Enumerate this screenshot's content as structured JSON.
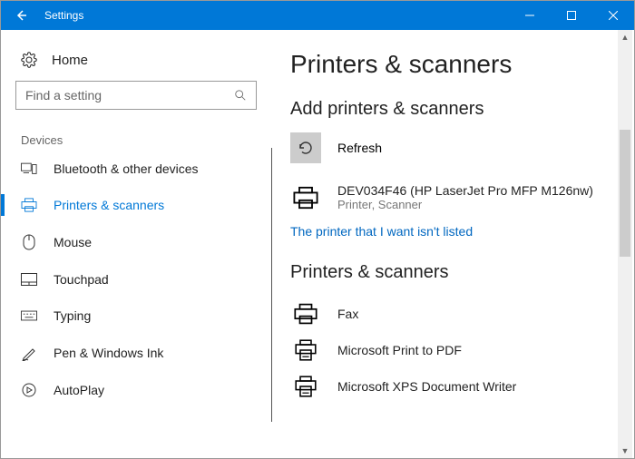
{
  "window": {
    "title": "Settings"
  },
  "sidebar": {
    "home_label": "Home",
    "search_placeholder": "Find a setting",
    "section_label": "Devices",
    "items": [
      {
        "label": "Bluetooth & other devices"
      },
      {
        "label": "Printers & scanners"
      },
      {
        "label": "Mouse"
      },
      {
        "label": "Touchpad"
      },
      {
        "label": "Typing"
      },
      {
        "label": "Pen & Windows Ink"
      },
      {
        "label": "AutoPlay"
      }
    ]
  },
  "main": {
    "heading": "Printers & scanners",
    "add_heading": "Add printers & scanners",
    "refresh_label": "Refresh",
    "found_device": {
      "name": "DEV034F46 (HP LaserJet Pro MFP M126nw)",
      "type": "Printer, Scanner"
    },
    "not_listed_link": "The printer that I want isn't listed",
    "list_heading": "Printers & scanners",
    "printers": [
      {
        "label": "Fax"
      },
      {
        "label": "Microsoft Print to PDF"
      },
      {
        "label": "Microsoft XPS Document Writer"
      }
    ]
  }
}
